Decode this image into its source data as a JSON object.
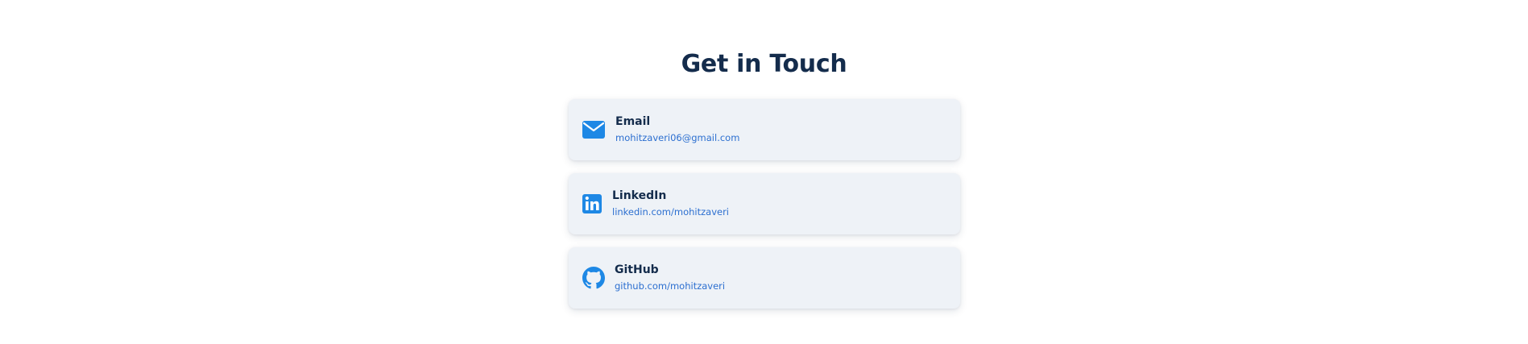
{
  "section": {
    "title": "Get in Touch"
  },
  "contacts": [
    {
      "label": "Email",
      "value": "mohitzaveri06@gmail.com",
      "icon": "envelope-icon"
    },
    {
      "label": "LinkedIn",
      "value": "linkedin.com/mohitzaveri",
      "icon": "linkedin-icon"
    },
    {
      "label": "GitHub",
      "value": "github.com/mohitzaveri",
      "icon": "github-icon"
    }
  ],
  "colors": {
    "accent": "#1e88e5",
    "heading": "#142c4c",
    "link": "#2c6fd0",
    "card_background": "#eef2f7"
  }
}
